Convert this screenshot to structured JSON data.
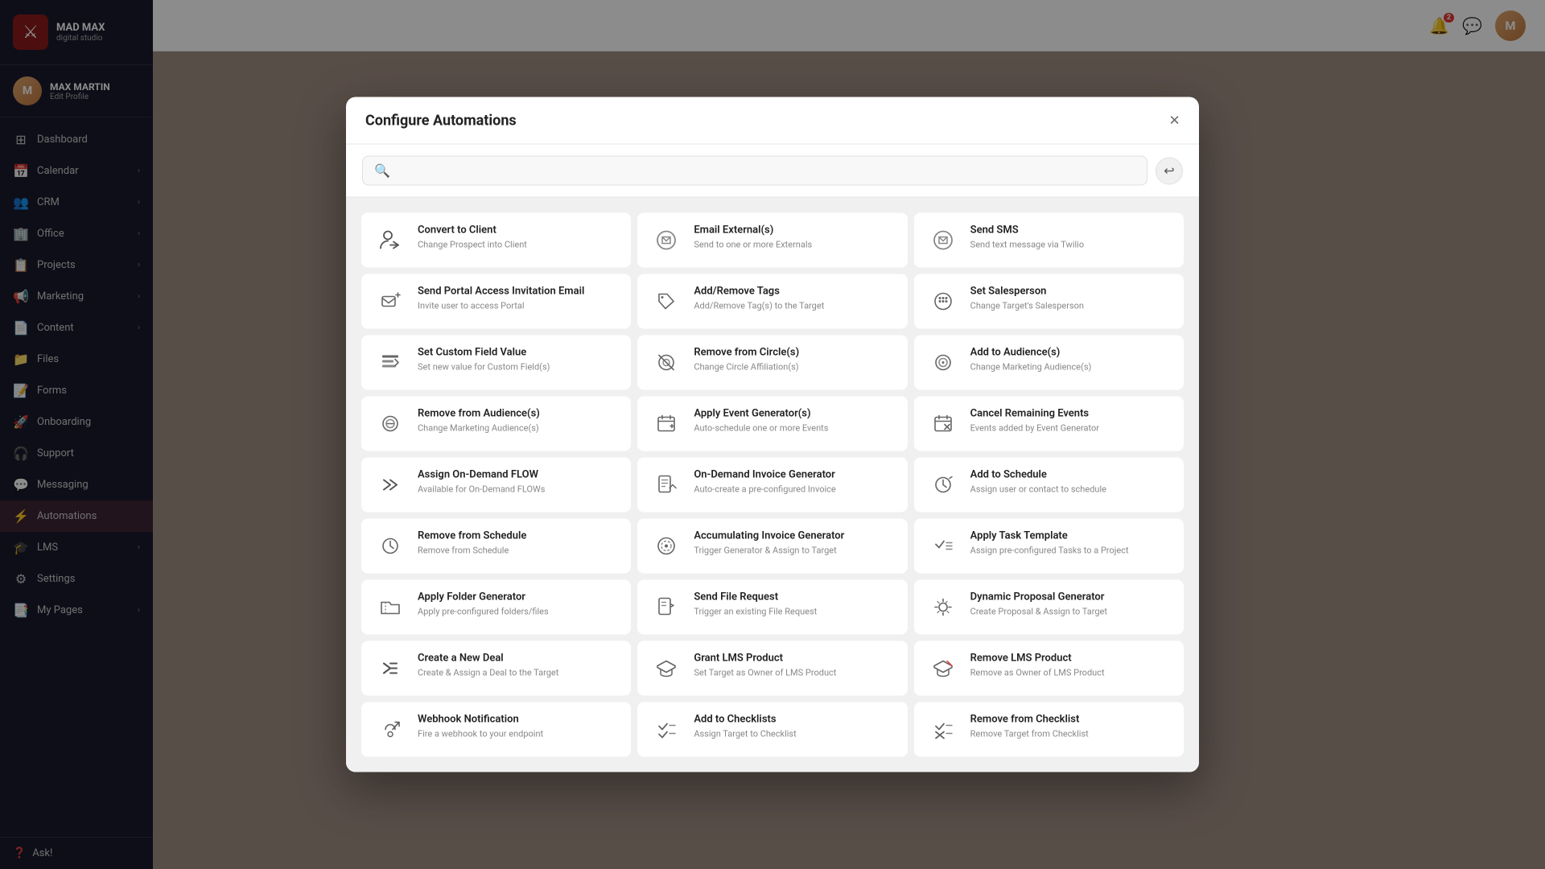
{
  "app": {
    "name": "MAD MAX",
    "subtitle": "digital studio"
  },
  "user": {
    "name": "MAX MARTIN",
    "edit_label": "Edit Profile",
    "initials": "M"
  },
  "sidebar": {
    "items": [
      {
        "id": "dashboard",
        "label": "Dashboard",
        "icon": "⊞",
        "has_chevron": false
      },
      {
        "id": "calendar",
        "label": "Calendar",
        "icon": "📅",
        "has_chevron": true
      },
      {
        "id": "crm",
        "label": "CRM",
        "icon": "👥",
        "has_chevron": true
      },
      {
        "id": "office",
        "label": "Office",
        "icon": "🏢",
        "has_chevron": true
      },
      {
        "id": "projects",
        "label": "Projects",
        "icon": "📋",
        "has_chevron": true
      },
      {
        "id": "marketing",
        "label": "Marketing",
        "icon": "📢",
        "has_chevron": true
      },
      {
        "id": "content",
        "label": "Content",
        "icon": "📄",
        "has_chevron": true
      },
      {
        "id": "files",
        "label": "Files",
        "icon": "📁",
        "has_chevron": false
      },
      {
        "id": "forms",
        "label": "Forms",
        "icon": "📝",
        "has_chevron": false
      },
      {
        "id": "onboarding",
        "label": "Onboarding",
        "icon": "🚀",
        "has_chevron": false
      },
      {
        "id": "support",
        "label": "Support",
        "icon": "🎧",
        "has_chevron": false
      },
      {
        "id": "messaging",
        "label": "Messaging",
        "icon": "💬",
        "has_chevron": false
      },
      {
        "id": "automations",
        "label": "Automations",
        "icon": "⚡",
        "has_chevron": false
      },
      {
        "id": "lms",
        "label": "LMS",
        "icon": "🎓",
        "has_chevron": true
      },
      {
        "id": "settings",
        "label": "Settings",
        "icon": "⚙",
        "has_chevron": false
      },
      {
        "id": "my-pages",
        "label": "My Pages",
        "icon": "📑",
        "has_chevron": true
      }
    ],
    "ask_label": "Ask!"
  },
  "topbar": {
    "notification_count": "2"
  },
  "modal": {
    "title": "Configure Automations",
    "close_label": "×",
    "search_placeholder": "",
    "back_label": "←",
    "cards": [
      {
        "id": "convert-to-client",
        "title": "Convert to Client",
        "desc": "Change Prospect into Client",
        "icon_type": "person-arrow"
      },
      {
        "id": "email-externals",
        "title": "Email External(s)",
        "desc": "Send to one or more Externals",
        "icon_type": "email"
      },
      {
        "id": "send-sms",
        "title": "Send SMS",
        "desc": "Send text message via Twilio",
        "icon_type": "sms"
      },
      {
        "id": "send-portal-access",
        "title": "Send Portal Access Invitation Email",
        "desc": "Invite user to access Portal",
        "icon_type": "portal-email"
      },
      {
        "id": "add-remove-tags",
        "title": "Add/Remove Tags",
        "desc": "Add/Remove Tag(s) to the Target",
        "icon_type": "tags"
      },
      {
        "id": "set-salesperson",
        "title": "Set Salesperson",
        "desc": "Change Target's Salesperson",
        "icon_type": "salesperson"
      },
      {
        "id": "set-custom-field",
        "title": "Set Custom Field Value",
        "desc": "Set new value for Custom Field(s)",
        "icon_type": "custom-field"
      },
      {
        "id": "remove-from-circle",
        "title": "Remove from Circle(s)",
        "desc": "Change Circle Affiliation(s)",
        "icon_type": "remove-circle"
      },
      {
        "id": "add-to-audiences",
        "title": "Add to Audience(s)",
        "desc": "Change Marketing Audience(s)",
        "icon_type": "add-audience"
      },
      {
        "id": "remove-from-audience",
        "title": "Remove from Audience(s)",
        "desc": "Change Marketing Audience(s)",
        "icon_type": "remove-audience"
      },
      {
        "id": "apply-event-generator",
        "title": "Apply Event Generator(s)",
        "desc": "Auto-schedule one or more Events",
        "icon_type": "event-gen"
      },
      {
        "id": "cancel-remaining-events",
        "title": "Cancel Remaining Events",
        "desc": "Events added by Event Generator",
        "icon_type": "cancel-events"
      },
      {
        "id": "assign-on-demand-flow",
        "title": "Assign On-Demand FLOW",
        "desc": "Available for On-Demand FLOWs",
        "icon_type": "on-demand"
      },
      {
        "id": "on-demand-invoice",
        "title": "On-Demand Invoice Generator",
        "desc": "Auto-create a pre-configured Invoice",
        "icon_type": "invoice"
      },
      {
        "id": "add-to-schedule",
        "title": "Add to Schedule",
        "desc": "Assign user or contact to schedule",
        "icon_type": "schedule"
      },
      {
        "id": "remove-from-schedule",
        "title": "Remove from Schedule",
        "desc": "Remove from Schedule",
        "icon_type": "remove-schedule"
      },
      {
        "id": "accumulating-invoice",
        "title": "Accumulating Invoice Generator",
        "desc": "Trigger Generator & Assign to Target",
        "icon_type": "acc-invoice"
      },
      {
        "id": "apply-task-template",
        "title": "Apply Task Template",
        "desc": "Assign pre-configured Tasks to a Project",
        "icon_type": "task"
      },
      {
        "id": "apply-folder-generator",
        "title": "Apply Folder Generator",
        "desc": "Apply pre-configured folders/files",
        "icon_type": "folder"
      },
      {
        "id": "send-file-request",
        "title": "Send File Request",
        "desc": "Trigger an existing File Request",
        "icon_type": "file-req"
      },
      {
        "id": "dynamic-proposal",
        "title": "Dynamic Proposal Generator",
        "desc": "Create Proposal & Assign to Target",
        "icon_type": "dynamic-prop"
      },
      {
        "id": "create-new-deal",
        "title": "Create a New Deal",
        "desc": "Create & Assign a Deal to the Target",
        "icon_type": "deal"
      },
      {
        "id": "grant-lms-product",
        "title": "Grant LMS Product",
        "desc": "Set Target as Owner of LMS Product",
        "icon_type": "lms-grant"
      },
      {
        "id": "remove-lms-product",
        "title": "Remove LMS Product",
        "desc": "Remove as Owner of LMS Product",
        "icon_type": "lms-remove"
      },
      {
        "id": "webhook-notification",
        "title": "Webhook Notification",
        "desc": "Fire a webhook to your endpoint",
        "icon_type": "webhook"
      },
      {
        "id": "add-to-checklists",
        "title": "Add to Checklists",
        "desc": "Assign Target to Checklist",
        "icon_type": "checklist-add"
      },
      {
        "id": "remove-from-checklist",
        "title": "Remove from Checklist",
        "desc": "Remove Target from Checklist",
        "icon_type": "checklist-remove"
      }
    ]
  }
}
